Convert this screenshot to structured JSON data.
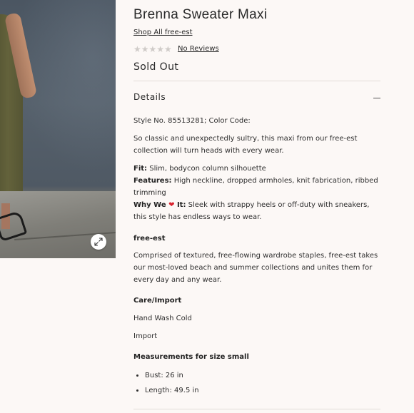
{
  "product": {
    "title": "Brenna Sweater Maxi",
    "shop_link": "Shop All free-est",
    "stars": "★★★★★",
    "reviews_link": "No Reviews",
    "status": "Sold Out"
  },
  "details": {
    "label": "Details",
    "style_line": "Style No. 85513281; Color Code:",
    "description": "So classic and unexpectedly sultry, this maxi from our free-est collection will turn heads with every wear.",
    "fit_label": "Fit:",
    "fit_text": " Slim, bodycon column silhouette",
    "features_label": "Features:",
    "features_text": " High neckline, dropped armholes, knit fabrication, ribbed trimming",
    "why_label_1": "Why We ",
    "why_heart": "❤",
    "why_label_2": " It:",
    "why_text": " Sleek with strappy heels or off-duty with sneakers, this style has endless ways to wear."
  },
  "brand": {
    "heading": "free-est",
    "text": "Comprised of textured, free-flowing wardrobe staples, free-est takes our most-loved beach and summer collections and unites them for every day and any wear."
  },
  "care": {
    "heading": "Care/Import",
    "wash": "Hand Wash Cold",
    "origin": "Import"
  },
  "measurements": {
    "heading": "Measurements for size small",
    "items": [
      "Bust: 26 in",
      "Length: 49.5 in"
    ]
  },
  "icons": {
    "zoom": "expand-arrows-icon",
    "collapse": "minus-icon",
    "heart": "heart-icon"
  },
  "colors": {
    "background": "#fcf8f6",
    "heart": "#d9232e",
    "star_empty": "#cfcbc8"
  }
}
